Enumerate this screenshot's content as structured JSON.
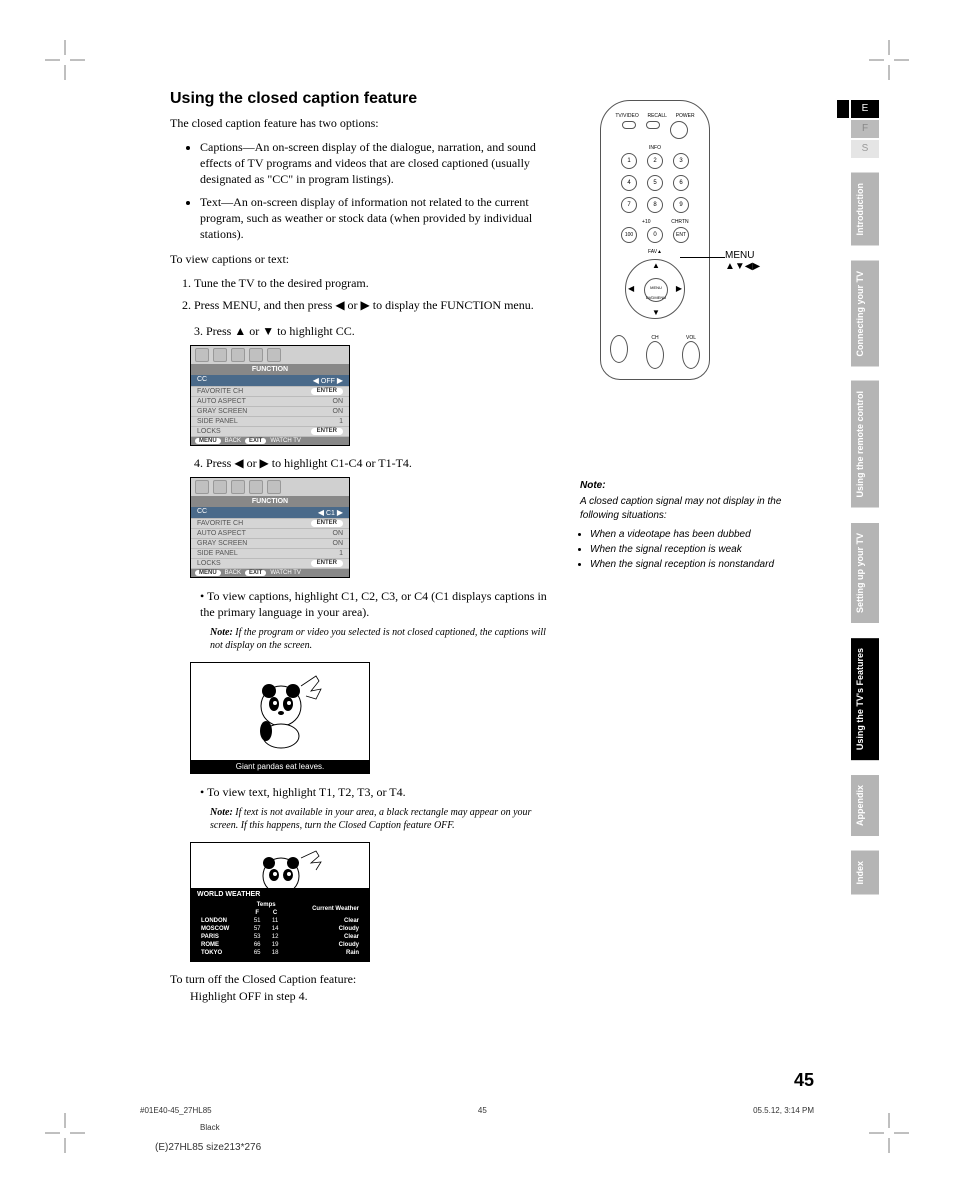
{
  "lang": {
    "e": "E",
    "f": "F",
    "s": "S"
  },
  "tabs": [
    "Introduction",
    "Connecting your TV",
    "Using the remote control",
    "Setting up your TV",
    "Using the TV's Features",
    "Appendix",
    "Index"
  ],
  "title": "Using the closed caption feature",
  "intro": "The closed caption feature has two options:",
  "bullets": [
    "Captions—An on-screen display of the dialogue, narration, and sound effects of TV programs and videos that are closed captioned (usually designated as \"CC\" in program listings).",
    "Text—An on-screen display of information not related to the current program, such as weather or stock data (when provided by individual stations)."
  ],
  "view_intro": "To view captions or text:",
  "steps": [
    "Tune the TV to the desired program.",
    "Press MENU, and then press ◀ or ▶ to display the FUNCTION menu."
  ],
  "step3": "Press ▲ or ▼ to highlight CC.",
  "step4": "Press ◀ or ▶ to highlight C1-C4 or T1-T4.",
  "menu": {
    "title": "FUNCTION",
    "rows": [
      {
        "k": "CC",
        "v_off": "OFF",
        "v_c1": "C1"
      },
      {
        "k": "FAVORITE CH",
        "v": "ENTER"
      },
      {
        "k": "AUTO ASPECT",
        "v": "ON"
      },
      {
        "k": "GRAY SCREEN",
        "v": "ON"
      },
      {
        "k": "SIDE PANEL",
        "v": "1"
      },
      {
        "k": "LOCKS",
        "v": "ENTER"
      }
    ],
    "footer": {
      "menu": "MENU",
      "back": "BACK",
      "exit": "EXIT",
      "watch": "WATCH TV"
    }
  },
  "sub1": "To view captions, highlight C1, C2, C3, or C4 (C1 displays captions in the primary language in your area).",
  "note1_label": "Note:",
  "note1": "If the program or video you selected is not closed captioned, the captions will not display on the screen.",
  "caption_example": "Giant pandas eat leaves.",
  "sub2": "To view text, highlight T1, T2, T3, or T4.",
  "note2": "If text is not available in your area, a black rectangle may appear on your screen. If this happens, turn the Closed Caption feature OFF.",
  "weather": {
    "title": "WORLD WEATHER",
    "header": {
      "temps": "Temps",
      "f": "F",
      "c": "C",
      "current": "Current Weather"
    },
    "rows": [
      {
        "city": "LONDON",
        "f": "51",
        "c": "11",
        "w": "Clear"
      },
      {
        "city": "MOSCOW",
        "f": "57",
        "c": "14",
        "w": "Cloudy"
      },
      {
        "city": "PARIS",
        "f": "53",
        "c": "12",
        "w": "Clear"
      },
      {
        "city": "ROME",
        "f": "66",
        "c": "19",
        "w": "Cloudy"
      },
      {
        "city": "TOKYO",
        "f": "65",
        "c": "18",
        "w": "Rain"
      }
    ]
  },
  "turn_off": "To turn off the Closed Caption feature:",
  "turn_off_sub": "Highlight OFF in step 4.",
  "remote": {
    "labels": {
      "tv": "TV/VIDEO",
      "recall": "RECALL",
      "power": "POWER",
      "info": "INFO",
      "plus10": "+10",
      "chrtn": "CHRTN",
      "menu": "MENU",
      "dvdmenu": "DVDMENU",
      "fav": "FAV▲",
      "ent": "ENT",
      "ch": "CH",
      "vol": "VOL"
    },
    "callout": "MENU",
    "callout2": "▲▼◀▶"
  },
  "note_block": {
    "head": "Note:",
    "body": "A closed caption signal may not display in the following situations:",
    "items": [
      "When a videotape has been dubbed",
      "When the signal reception is weak",
      "When the signal reception is nonstandard"
    ]
  },
  "page_num": "45",
  "footer": {
    "file": "#01E40-45_27HL85",
    "pg": "45",
    "date": "05.5.12, 3:14 PM",
    "black": "Black",
    "size": "(E)27HL85 size213*276"
  }
}
